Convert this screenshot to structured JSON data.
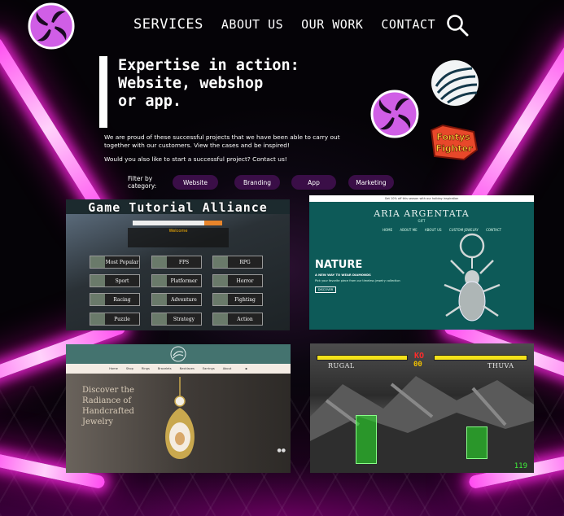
{
  "nav": {
    "items": [
      "SERVICES",
      "ABOUT US",
      "OUR WORK",
      "CONTACT"
    ]
  },
  "hero": {
    "headline_lines": [
      "Expertise in action:",
      "Website, webshop",
      "or app."
    ],
    "intro": "We are proud of these successful projects that we have been able to carry out together with our customers. View the cases and be inspired!",
    "cta": "Would you also like to start a successful project? Contact us!"
  },
  "badges": {
    "fonty_text_1": "Fontys",
    "fonty_text_2": "Fighter"
  },
  "filter": {
    "label_line1": "Filter by",
    "label_line2": "category:",
    "chips": [
      "Website",
      "Branding",
      "App",
      "Marketing"
    ]
  },
  "cases": {
    "game_tutorial": {
      "title": "Game Tutorial Alliance",
      "welcome": "Welcome",
      "genres": [
        "Most Popular",
        "FPS",
        "RPG",
        "Sport",
        "Platformer",
        "Horror",
        "Racing",
        "Adventure",
        "Fighting",
        "Puzzle",
        "Strategy",
        "Action"
      ]
    },
    "aria_argentata": {
      "top_banner": "Get 10% off this season with our holiday inspiration",
      "logo": "ARIA ARGENTATA",
      "sub": "GIFT",
      "nav": [
        "HOME",
        "ABOUT ME",
        "ABOUT US",
        "CUSTOM JEWELRY",
        "CONTACT"
      ],
      "heading": "NATURE",
      "tagline": "A NEW WAY TO WEAR DIAMONDS",
      "text": "Pick your favorite piece from our timeless jewelry collection",
      "button": "DISCOVER"
    },
    "jewelry": {
      "nav": [
        "Home",
        "Shop",
        "Rings",
        "Bracelets",
        "Necklaces",
        "Earrings",
        "About"
      ],
      "title": "Discover the Radiance of Handcrafted Jewelry",
      "dots": "●●"
    },
    "fighter_game": {
      "ko": "KO",
      "timer": "00",
      "player1": "RUGAL",
      "player2": "THUVA",
      "score": "119"
    }
  },
  "colors": {
    "neon": "#ff40f0",
    "logo_purple": "#c04ad8",
    "chip_bg": "#3a0e47",
    "fonty_orange": "#e8482a"
  }
}
